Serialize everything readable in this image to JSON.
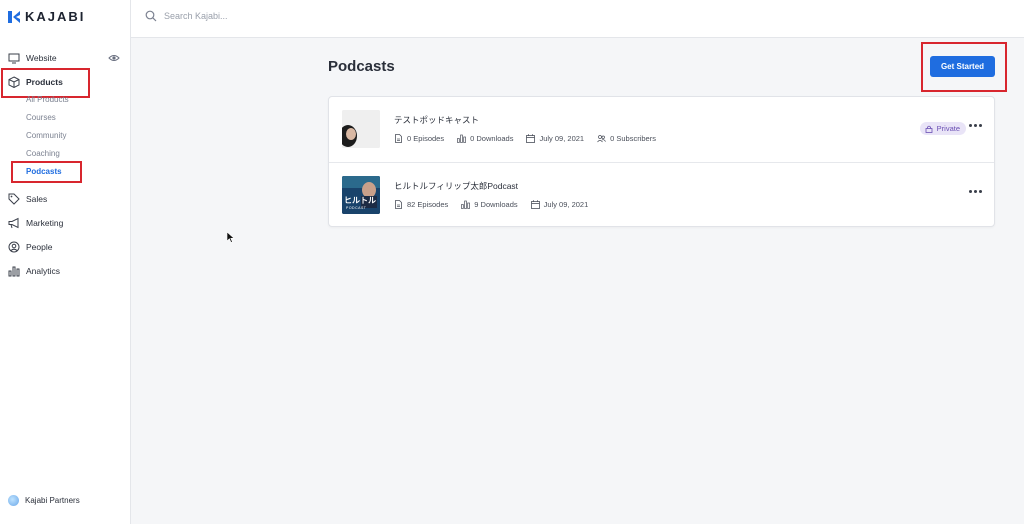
{
  "brand": {
    "name": "KAJABI"
  },
  "search": {
    "placeholder": "Search Kajabi..."
  },
  "sidebar": {
    "items": [
      {
        "label": "Website",
        "icon": "monitor-icon"
      },
      {
        "label": "Products",
        "icon": "box-icon"
      },
      {
        "label": "Sales",
        "icon": "tag-icon"
      },
      {
        "label": "Marketing",
        "icon": "megaphone-icon"
      },
      {
        "label": "People",
        "icon": "person-icon"
      },
      {
        "label": "Analytics",
        "icon": "bar-chart-icon"
      }
    ],
    "product_subitems": [
      "All Products",
      "Courses",
      "Community",
      "Coaching",
      "Podcasts"
    ],
    "active_subitem": "Podcasts",
    "footer": {
      "partners_label": "Kajabi Partners"
    }
  },
  "main": {
    "title": "Podcasts",
    "cta_label": "Get Started",
    "podcasts": [
      {
        "title": "テストポッドキャスト",
        "episodes": "0 Episodes",
        "downloads": "0 Downloads",
        "date": "July 09, 2021",
        "subscribers": "0 Subscribers",
        "badge": "Private"
      },
      {
        "title": "ヒルトルフィリップ太郎Podcast",
        "episodes": "82 Episodes",
        "downloads": "9 Downloads",
        "date": "July 09, 2021",
        "thumb_text": "ヒルトル",
        "thumb_subtext": "PODCAST"
      }
    ]
  },
  "colors": {
    "accent": "#1f6de0",
    "highlight": "#d8262e",
    "badge_bg": "#e9e4f7",
    "badge_fg": "#6a4fb3"
  }
}
